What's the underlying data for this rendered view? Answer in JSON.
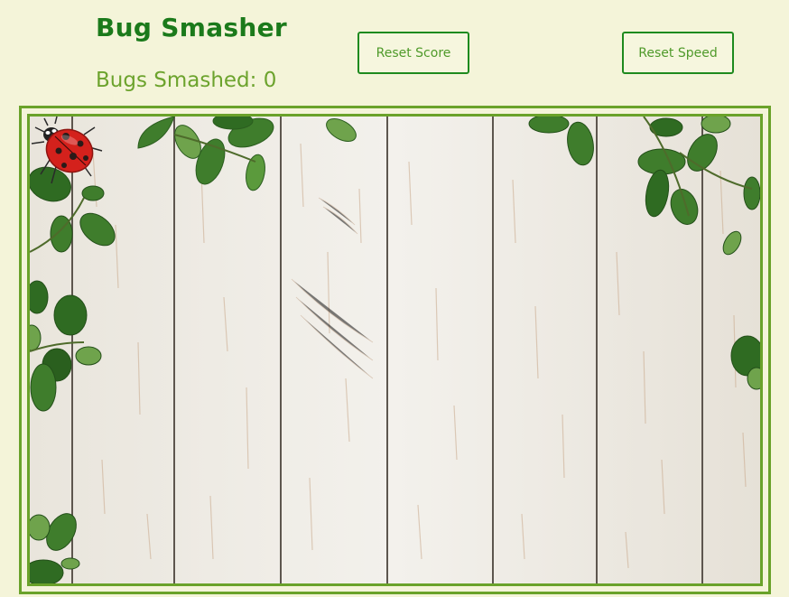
{
  "game": {
    "title": "Bug Smasher",
    "score_label": "Bugs Smashed: 0",
    "reset_score_label": "Reset Score",
    "reset_speed_label": "Reset Speed"
  },
  "board": {
    "background": "wooden-planks-with-leaves",
    "bug": "ladybug-icon"
  },
  "colors": {
    "title": "#1b7a1b",
    "score": "#6ca32d",
    "border": "#6aa22a",
    "page": "#f4f4d9"
  }
}
